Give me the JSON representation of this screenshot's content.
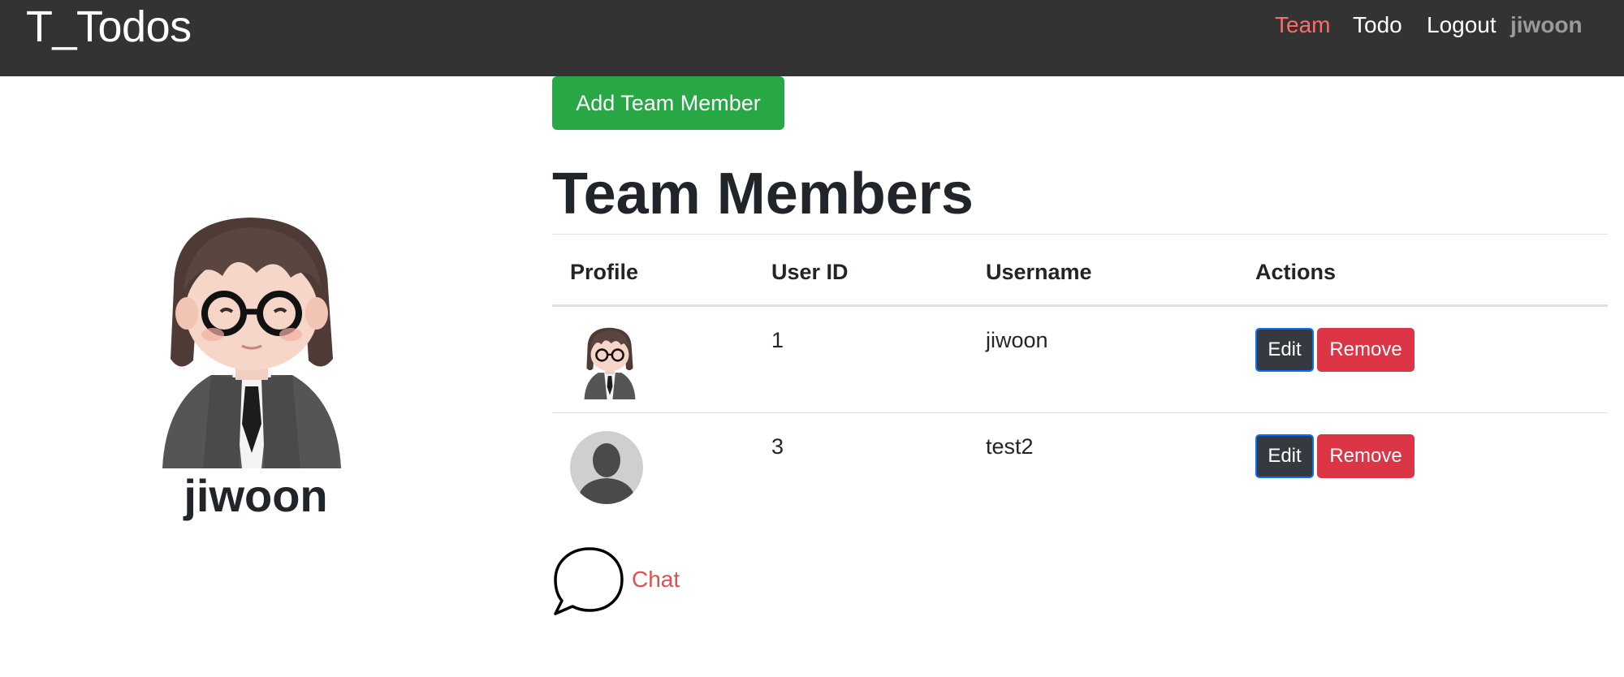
{
  "app": {
    "brand": "T_Todos"
  },
  "nav": {
    "items": [
      {
        "label": "Team",
        "active": true
      },
      {
        "label": "Todo",
        "active": false
      },
      {
        "label": "Logout",
        "active": false
      }
    ],
    "current_user": "jiwoon"
  },
  "sidebar": {
    "username": "jiwoon",
    "avatar": "3d-avatar-man-glasses-suit"
  },
  "main": {
    "add_button": "Add Team Member",
    "title": "Team Members",
    "table": {
      "headers": [
        "Profile",
        "User ID",
        "Username",
        "Actions"
      ],
      "rows": [
        {
          "avatar": "3d-avatar-man-glasses-suit",
          "user_id": "1",
          "username": "jiwoon",
          "edit": "Edit",
          "remove": "Remove"
        },
        {
          "avatar": "default-person-icon",
          "user_id": "3",
          "username": "test2",
          "edit": "Edit",
          "remove": "Remove"
        }
      ]
    },
    "chat": {
      "label": "Chat",
      "icon": "speech-bubble-icon"
    }
  },
  "colors": {
    "navbar": "#333333",
    "active_nav": "#ff6b6b",
    "add_button": "#28a745",
    "edit_button": "#343a40",
    "remove_button": "#dc3545",
    "chat_label": "#e05050"
  }
}
